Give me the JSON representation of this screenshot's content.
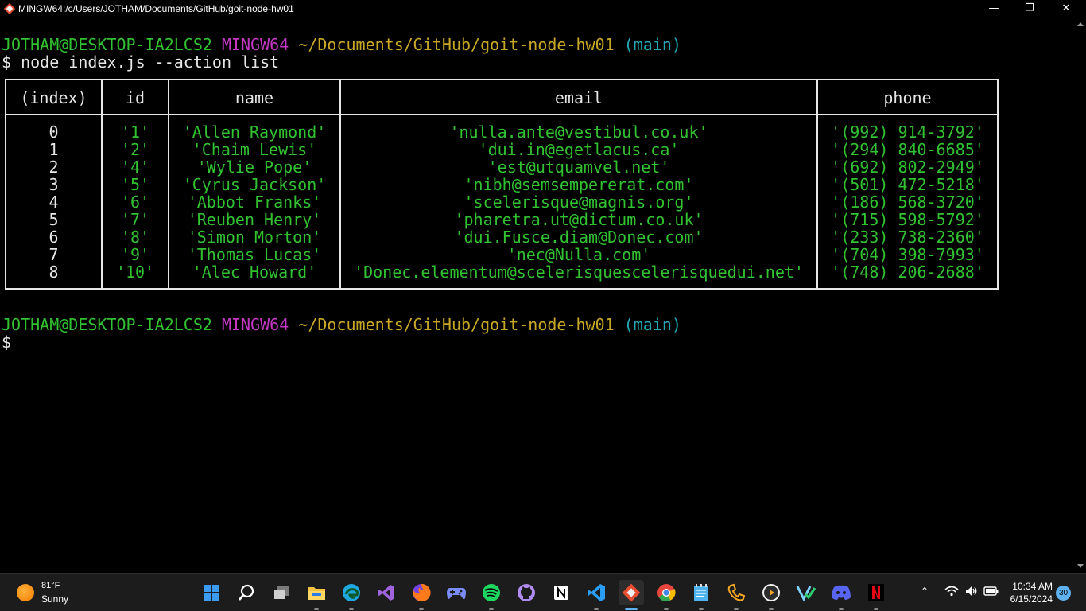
{
  "window": {
    "title": "MINGW64:/c/Users/JOTHAM/Documents/GitHub/goit-node-hw01",
    "minimize": "—",
    "restore": "❐",
    "close": "✕"
  },
  "terminal": {
    "prompt1": {
      "user": "JOTHAM@DESKTOP-IA2LCS2",
      "env": "MINGW64",
      "path": "~/Documents/GitHub/goit-node-hw01",
      "branch": "(main)"
    },
    "command": "$ node index.js --action list",
    "prompt2": {
      "user": "JOTHAM@DESKTOP-IA2LCS2",
      "env": "MINGW64",
      "path": "~/Documents/GitHub/goit-node-hw01",
      "branch": "(main)"
    },
    "cursor_prompt": "$"
  },
  "table": {
    "headers": [
      "(index)",
      "id",
      "name",
      "email",
      "phone"
    ],
    "rows": [
      [
        "0",
        "'1'",
        "'Allen Raymond'",
        "'nulla.ante@vestibul.co.uk'",
        "'(992) 914-3792'"
      ],
      [
        "1",
        "'2'",
        "'Chaim Lewis'",
        "'dui.in@egetlacus.ca'",
        "'(294) 840-6685'"
      ],
      [
        "2",
        "'4'",
        "'Wylie Pope'",
        "'est@utquamvel.net'",
        "'(692) 802-2949'"
      ],
      [
        "3",
        "'5'",
        "'Cyrus Jackson'",
        "'nibh@semsempererat.com'",
        "'(501) 472-5218'"
      ],
      [
        "4",
        "'6'",
        "'Abbot Franks'",
        "'scelerisque@magnis.org'",
        "'(186) 568-3720'"
      ],
      [
        "5",
        "'7'",
        "'Reuben Henry'",
        "'pharetra.ut@dictum.co.uk'",
        "'(715) 598-5792'"
      ],
      [
        "6",
        "'8'",
        "'Simon Morton'",
        "'dui.Fusce.diam@Donec.com'",
        "'(233) 738-2360'"
      ],
      [
        "7",
        "'9'",
        "'Thomas Lucas'",
        "'nec@Nulla.com'",
        "'(704) 398-7993'"
      ],
      [
        "8",
        "'10'",
        "'Alec Howard'",
        "'Donec.elementum@scelerisquescelerisquedui.net'",
        "'(748) 206-2688'"
      ]
    ]
  },
  "taskbar": {
    "weather": {
      "temp": "81°F",
      "condition": "Sunny"
    },
    "apps": [
      {
        "name": "start",
        "color": "#3a9bf0"
      },
      {
        "name": "search",
        "color": "#ffffff"
      },
      {
        "name": "task-view",
        "color": "#cfcfcf"
      },
      {
        "name": "file-explorer",
        "color": "#f5c242"
      },
      {
        "name": "edge",
        "color": "#1fa8e0"
      },
      {
        "name": "visual-studio",
        "color": "#a064dc"
      },
      {
        "name": "firefox",
        "color": "#ff7a1a"
      },
      {
        "name": "game-controller",
        "color": "#7b8cff"
      },
      {
        "name": "spotify",
        "color": "#1ed760"
      },
      {
        "name": "github",
        "color": "#b18cf0"
      },
      {
        "name": "notion",
        "color": "#ffffff"
      },
      {
        "name": "vscode",
        "color": "#2a9df4"
      },
      {
        "name": "git-bash",
        "color": "#f0f0f0"
      },
      {
        "name": "chrome",
        "color": "#e8453c"
      },
      {
        "name": "notepad",
        "color": "#4fb3f0"
      },
      {
        "name": "phone-link",
        "color": "#f5a623"
      },
      {
        "name": "media-player",
        "color": "#f0f0f0"
      },
      {
        "name": "vpn",
        "color": "#2ecc71"
      },
      {
        "name": "discord",
        "color": "#5865f2"
      },
      {
        "name": "netflix",
        "color": "#e50914"
      }
    ],
    "clock": {
      "time": "10:34 AM",
      "date": "6/15/2024"
    },
    "notifications": "30"
  }
}
